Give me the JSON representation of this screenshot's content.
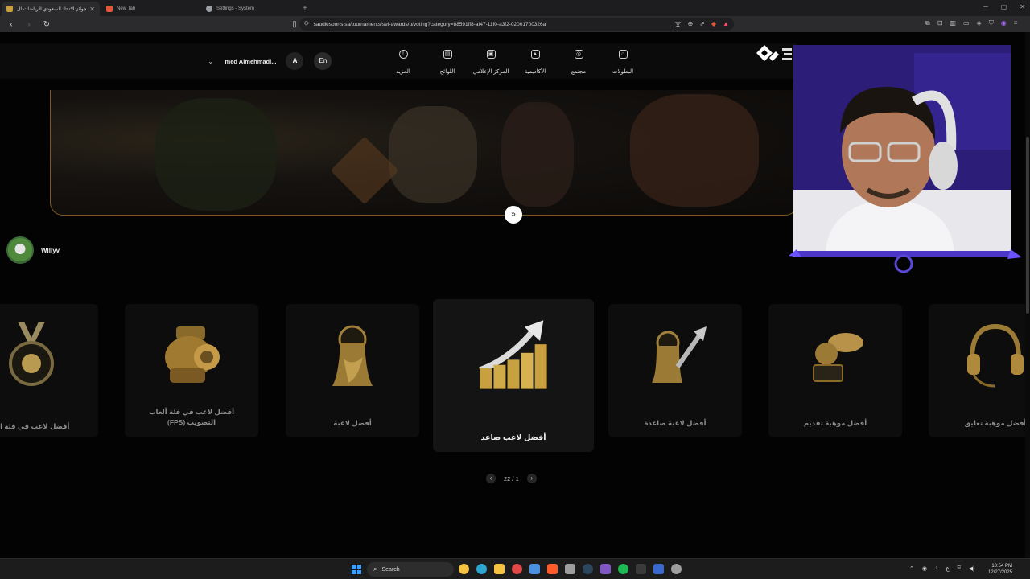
{
  "browser": {
    "tabs": [
      {
        "title": "جوائز الاتحاد السعودي للرياضات ال",
        "active": true,
        "favicon_color": "#c8a040"
      },
      {
        "title": "New Tab",
        "active": false,
        "favicon_color": "#e2573a"
      },
      {
        "title": "Settings - System",
        "active": false,
        "favicon_color": "#9aa0a6"
      }
    ],
    "new_tab_label": "+",
    "url": "saudiesports.sa/tournaments/sef-awards/u/voting?category=88591ff8-af47-11f0-a3f2-02001700326a"
  },
  "site_nav": {
    "items": [
      {
        "label": "البطولات",
        "icon": "trophy-icon",
        "glyph": "⌂"
      },
      {
        "label": "مجتمع",
        "icon": "community-icon",
        "glyph": "◎"
      },
      {
        "label": "الأكاديمية",
        "icon": "academy-icon",
        "glyph": "▲"
      },
      {
        "label": "المركز الإعلامي",
        "icon": "media-icon",
        "glyph": "▣"
      },
      {
        "label": "اللوائح",
        "icon": "rules-icon",
        "glyph": "▤"
      },
      {
        "label": "المزيد",
        "icon": "more-icon",
        "glyph": "!"
      }
    ],
    "user_name": "med Almehmadi...",
    "avatar_letter": "A",
    "language_button": "En"
  },
  "viewer": {
    "name": "Wlllyv"
  },
  "categories": [
    {
      "label": "أفضل لاعب في فئة الر",
      "art": "medal",
      "active": false
    },
    {
      "label": "أفضل لاعب في فئة ألعاب التصويب (FPS)",
      "art": "helmet",
      "active": false
    },
    {
      "label": "أفضل لاعبة",
      "art": "player-female",
      "active": false
    },
    {
      "label": "أفضل لاعب صاعد",
      "art": "rising-chart",
      "active": true
    },
    {
      "label": "أفضل لاعبة صاعدة",
      "art": "rising-female",
      "active": false
    },
    {
      "label": "أفضل موهبة تقديم",
      "art": "host-mic",
      "active": false
    },
    {
      "label": "أفضل موهبة تعليق",
      "art": "headset",
      "active": false
    }
  ],
  "pager": {
    "text": "22 / 1"
  },
  "taskbar": {
    "search_placeholder": "Search",
    "time": "10:54 PM",
    "date": "12/27/2025",
    "tray_lang": "ع",
    "app_colors": [
      "#3a8ff0",
      "#4caf50",
      "#2196f3",
      "#f5c242",
      "#e04848",
      "#6fa8ff",
      "#ff7043",
      "#ab47bc",
      "#1db954",
      "#4a90e2",
      "#7e57c2",
      "#5c6bc0",
      "#9e9e9e"
    ]
  },
  "colors": {
    "accent_gold": "#c9a24a",
    "cam_purple": "#4b36c8"
  }
}
